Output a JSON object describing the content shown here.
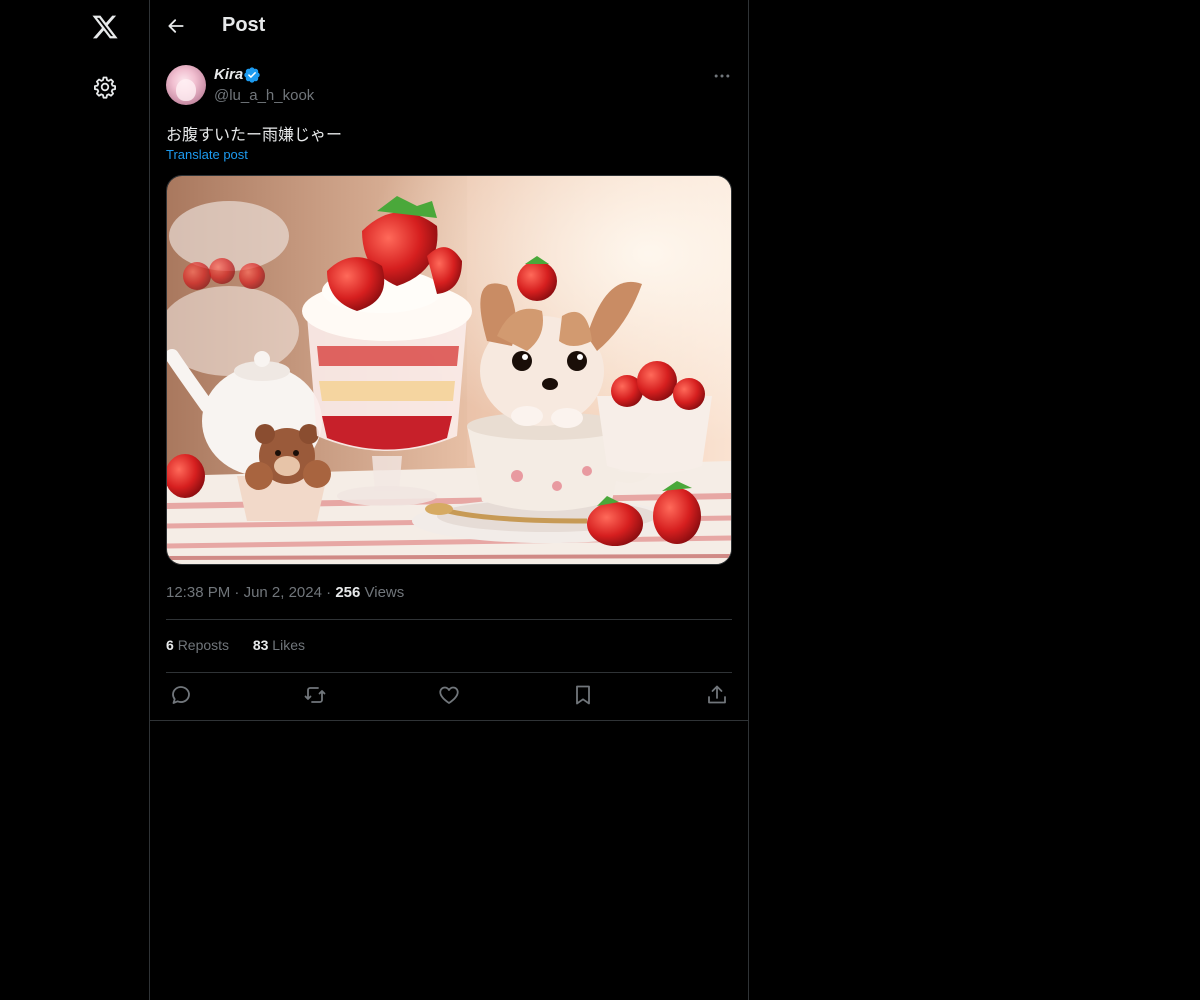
{
  "header": {
    "title": "Post"
  },
  "post": {
    "author_name": "Kira",
    "author_handle": "@lu_a_h_kook",
    "text": "お腹すいたー雨嫌じゃー",
    "translate_label": "Translate post",
    "time": "12:38 PM",
    "date": "Jun 2, 2024",
    "views_count": "256",
    "views_label": "Views",
    "reposts_count": "6",
    "reposts_label": "Reposts",
    "likes_count": "83",
    "likes_label": "Likes"
  },
  "icons": {
    "logo": "x-logo-icon",
    "settings": "gear-icon",
    "back": "back-arrow-icon",
    "verified": "verified-badge-icon",
    "more": "more-icon",
    "reply": "reply-icon",
    "repost": "repost-icon",
    "like": "heart-icon",
    "bookmark": "bookmark-icon",
    "share": "share-icon"
  },
  "colors": {
    "accent": "#1d9bf0",
    "muted": "#71767b",
    "text": "#e7e9ea",
    "border": "#2f3336"
  }
}
